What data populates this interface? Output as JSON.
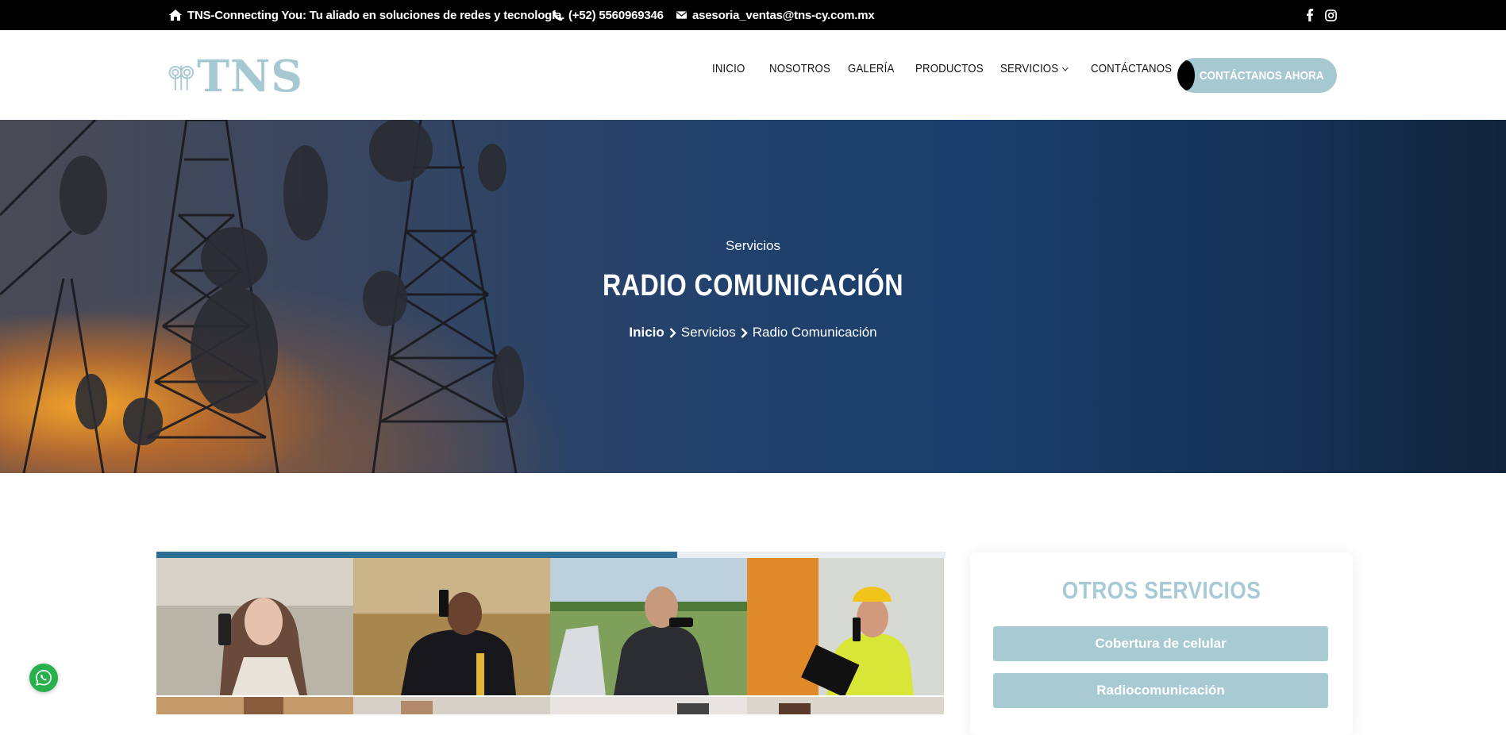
{
  "topbar": {
    "tagline": "TNS-Connecting You: Tu aliado en soluciones de redes y tecnología.",
    "phone": "(+52) 5560969346",
    "email": "asesoria_ventas@tns-cy.com.mx",
    "icons": [
      "home-icon",
      "phone-icon",
      "envelope-icon",
      "facebook-icon",
      "instagram-icon"
    ]
  },
  "header": {
    "logo_text": "TNS",
    "nav": [
      "INICIO",
      "NOSOTROS",
      "GALERÍA",
      "PRODUCTOS",
      "SERVICIOS",
      "CONTÁCTANOS"
    ],
    "cta_label": "CONTÁCTANOS AHORA"
  },
  "hero": {
    "subtitle": "Servicios",
    "title": "RADIO COMUNICACIÓN",
    "breadcrumb": [
      "Inicio",
      "Servicios",
      "Radio Comunicación"
    ]
  },
  "sidebar": {
    "title": "OTROS SERVICIOS",
    "services": [
      "Cobertura de celular",
      "Radiocomunicación"
    ]
  },
  "colors": {
    "accent": "#a6c8d3",
    "topbar": "#000000",
    "progress": "#2d6f95",
    "whatsapp": "#27b04b"
  },
  "gallery": {
    "progress": 0.66
  }
}
